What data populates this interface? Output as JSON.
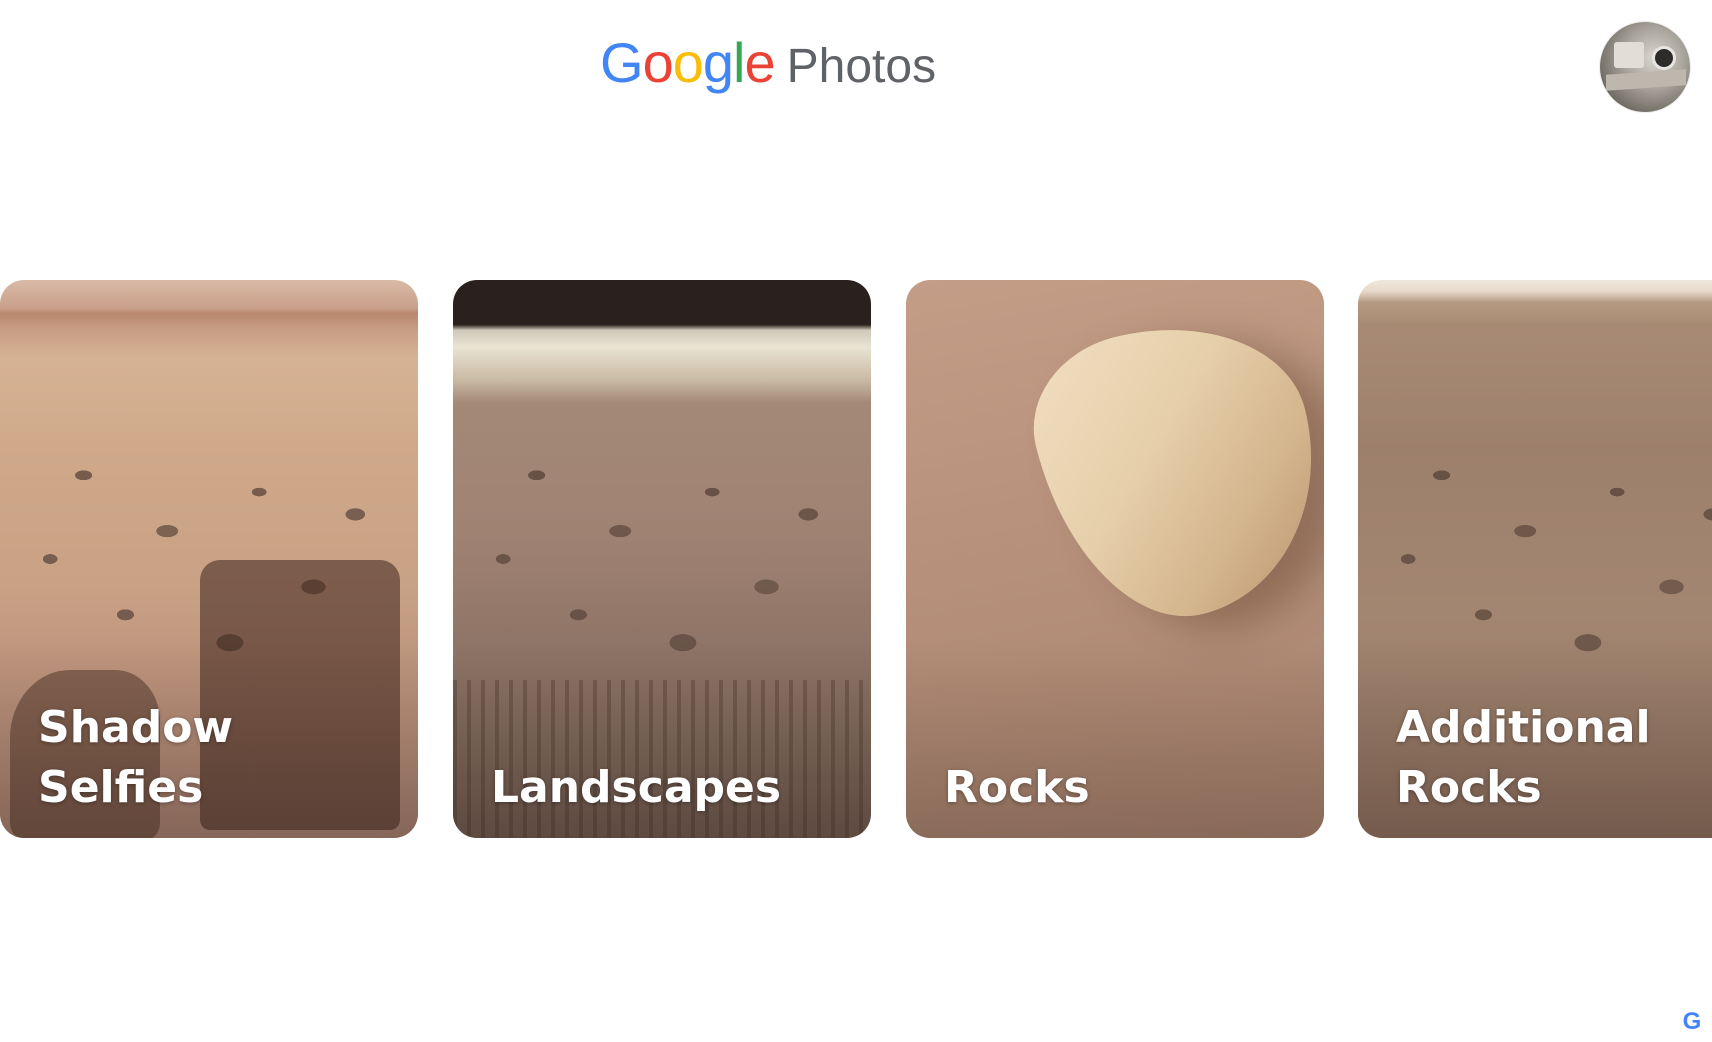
{
  "header": {
    "logo_letters": [
      {
        "char": "G",
        "color": "#4285F4"
      },
      {
        "char": "o",
        "color": "#EA4335"
      },
      {
        "char": "o",
        "color": "#FBBC05"
      },
      {
        "char": "g",
        "color": "#4285F4"
      },
      {
        "char": "l",
        "color": "#34A853"
      },
      {
        "char": "e",
        "color": "#EA4335"
      }
    ],
    "product": "Photos",
    "avatar_icon": "user-avatar"
  },
  "albums": [
    {
      "title": "Shadow\nSelfies"
    },
    {
      "title": "Landscapes"
    },
    {
      "title": "Rocks"
    },
    {
      "title": "Additional\nRocks"
    }
  ],
  "footer": {
    "corner_mark": "G"
  }
}
